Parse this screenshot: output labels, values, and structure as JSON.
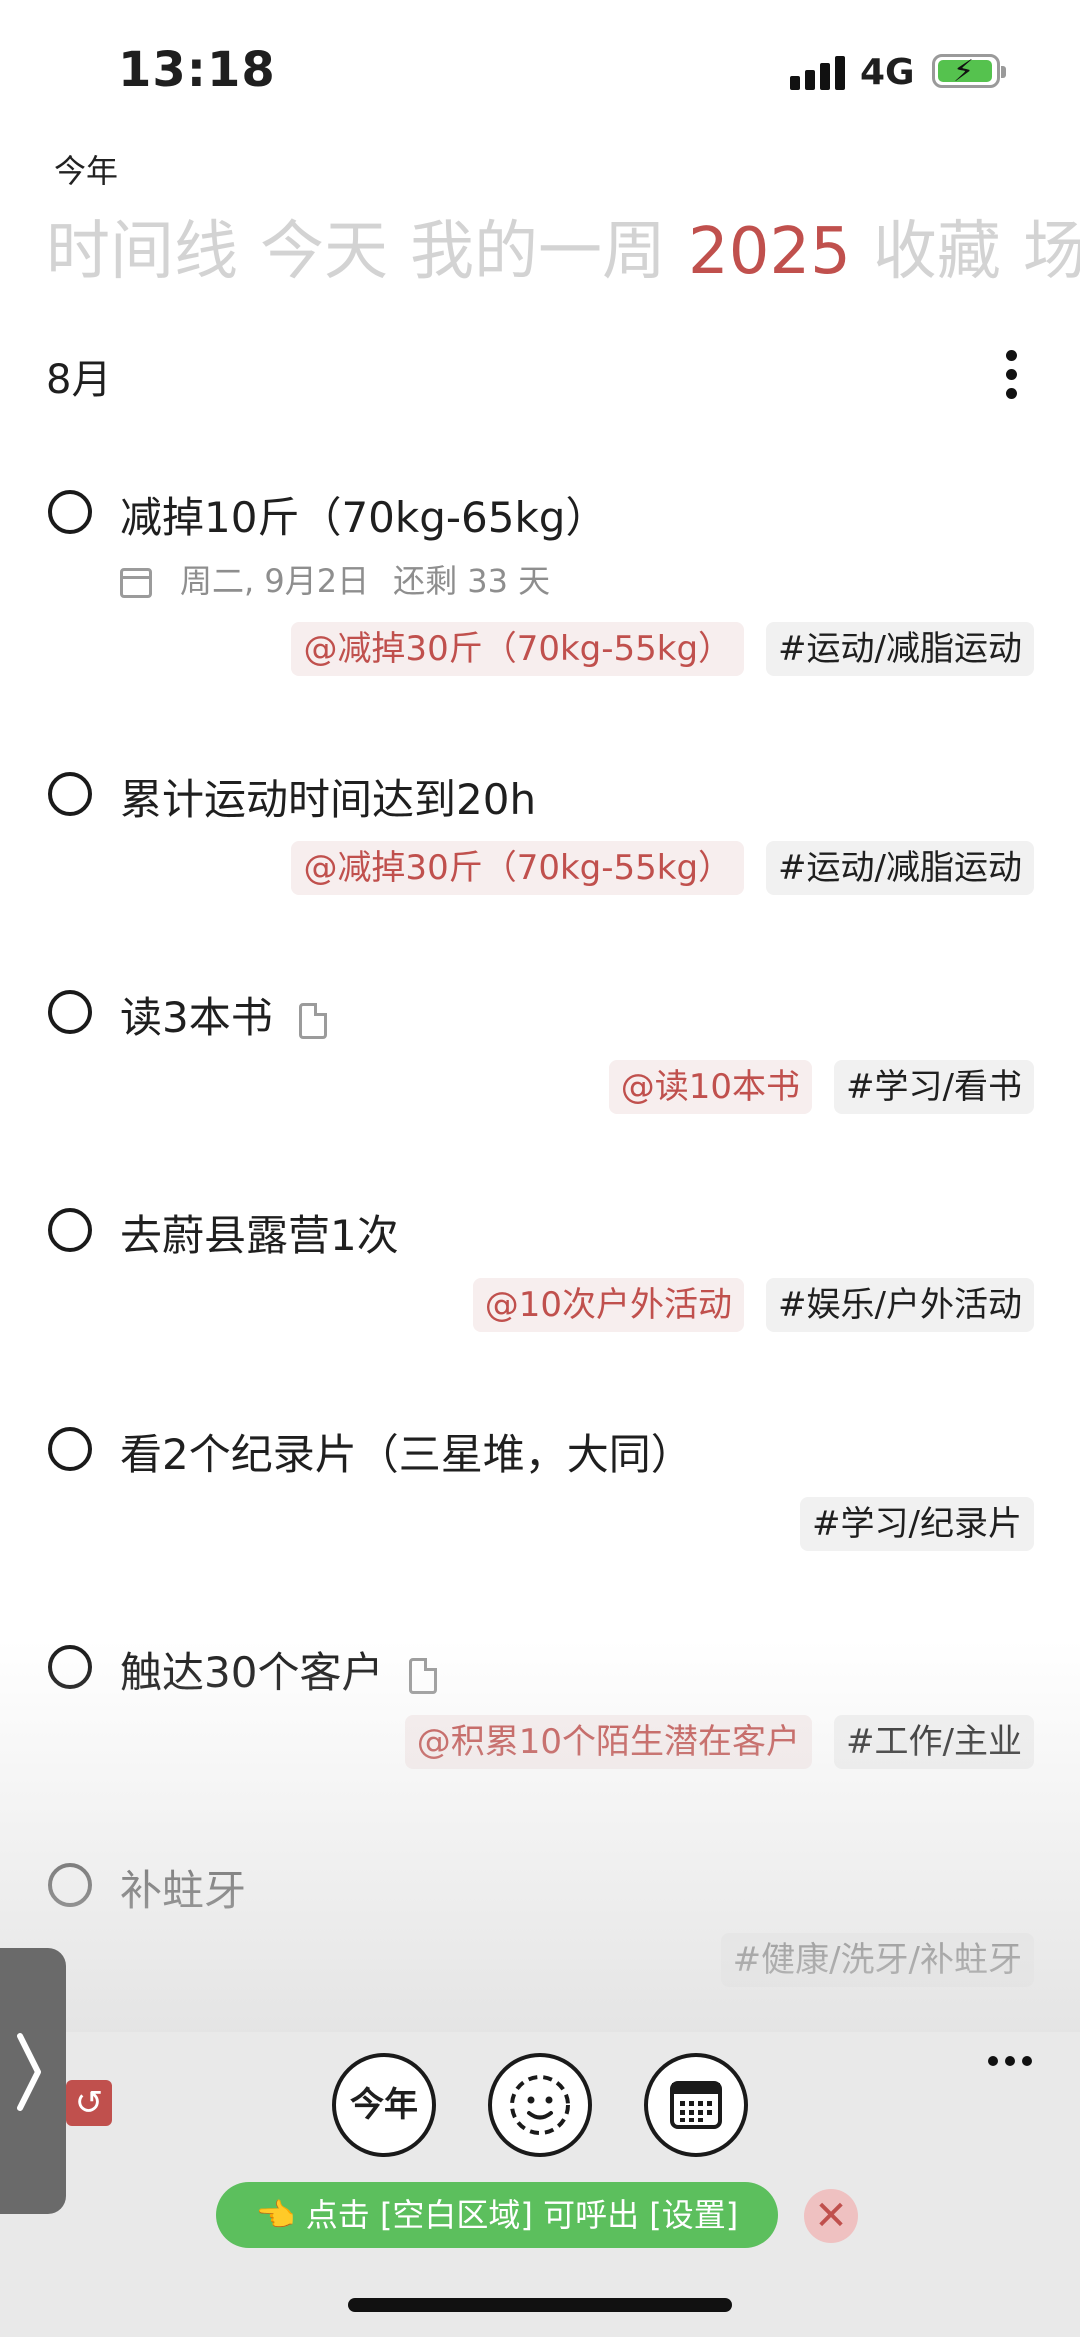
{
  "status_bar": {
    "time": "13:18",
    "network": "4G",
    "battery_icon": "battery-charging-icon"
  },
  "header": {
    "small_title": "今年",
    "tabs": [
      {
        "label": "时间线",
        "active": false
      },
      {
        "label": "今天",
        "active": false
      },
      {
        "label": "我的一周",
        "active": false
      },
      {
        "label": "2025",
        "active": true
      },
      {
        "label": "收藏",
        "active": false
      },
      {
        "label": "场",
        "active": false
      }
    ]
  },
  "section": {
    "month": "8月"
  },
  "goals": [
    {
      "title": "减掉10斤（70kg-65kg）",
      "due": "周二, 9月2日",
      "remaining": "还剩 33 天",
      "parent": "@减掉30斤（70kg-55kg）",
      "category": "#运动/减脂运动"
    },
    {
      "title": "累计运动时间达到20h",
      "parent": "@减掉30斤（70kg-55kg）",
      "category": "#运动/减脂运动"
    },
    {
      "title": "读3本书",
      "has_note": true,
      "parent": "@读10本书",
      "category": "#学习/看书"
    },
    {
      "title": "去蔚县露营1次",
      "parent": "@10次户外活动",
      "category": "#娱乐/户外活动"
    },
    {
      "title": "看2个纪录片（三星堆，大同）",
      "category": "#学习/纪录片"
    },
    {
      "title": "触达30个客户",
      "has_note": true,
      "parent": "@积累10个陌生潜在客户",
      "category": "#工作/主业"
    },
    {
      "title": "补蛀牙",
      "category": "#健康/洗牙/补蛀牙"
    }
  ],
  "toolbar": {
    "year_button": "今年",
    "hint": "👈 点击 [空白区域] 可呼出 [设置]",
    "close_symbol": "✕",
    "undo_symbol": "↺"
  },
  "colors": {
    "accent": "#c0504d",
    "tab_inactive": "#d3d3d3",
    "hint_green": "#5cbf5d"
  }
}
